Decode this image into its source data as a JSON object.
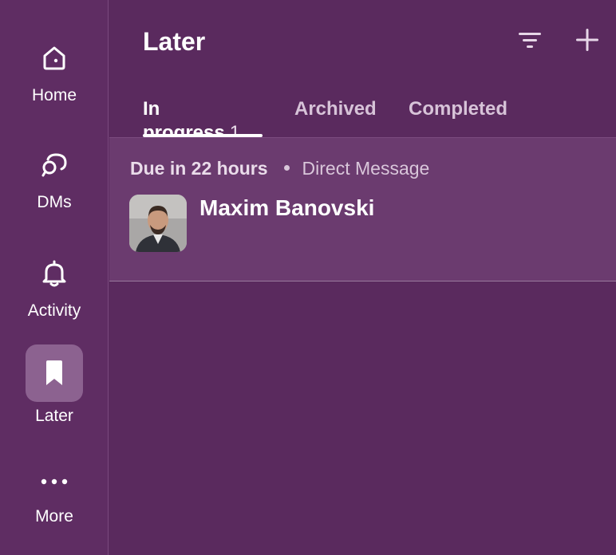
{
  "rail": {
    "items": [
      {
        "label": "Home",
        "icon": "home-icon"
      },
      {
        "label": "DMs",
        "icon": "dms-icon"
      },
      {
        "label": "Activity",
        "icon": "bell-icon"
      },
      {
        "label": "Later",
        "icon": "bookmark-icon",
        "active": true
      },
      {
        "label": "More",
        "icon": "more-icon"
      }
    ]
  },
  "header": {
    "title": "Later",
    "filter_icon": "filter-icon",
    "add_icon": "plus-icon"
  },
  "tabs": [
    {
      "label": "In progress",
      "count": "1",
      "active": true
    },
    {
      "label": "Archived"
    },
    {
      "label": "Completed"
    }
  ],
  "items": [
    {
      "due": "Due in 22 hours",
      "kind": "Direct Message",
      "name": "Maxim Banovski"
    }
  ],
  "colors": {
    "background": "#5a2a5e",
    "rail": "#5f2d63",
    "active_rail": "#8c6290",
    "item_bg": "#6b3b6f"
  }
}
